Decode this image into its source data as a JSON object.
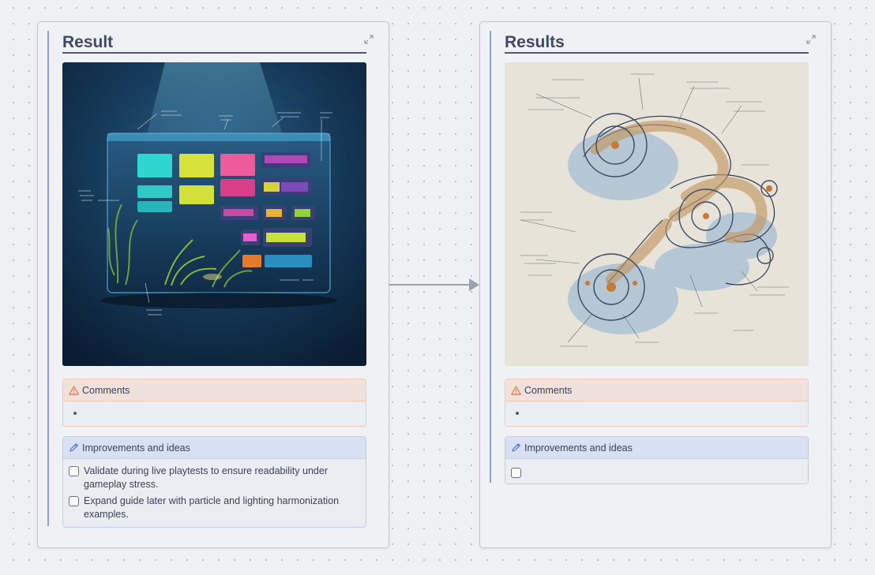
{
  "left_card": {
    "title": "Result",
    "comments": {
      "header": "Comments",
      "items": [
        ""
      ]
    },
    "ideas": {
      "header": "Improvements and ideas",
      "items": [
        "Validate during live playtests to ensure readability under gameplay stress.",
        "Expand guide later with particle and lighting harmonization examples."
      ]
    }
  },
  "right_card": {
    "title": "Results",
    "comments": {
      "header": "Comments",
      "items": [
        ""
      ]
    },
    "ideas": {
      "header": "Improvements and ideas",
      "items": [
        ""
      ]
    }
  },
  "colors": {
    "accent": "#8d9ce8",
    "warning_icon": "#e8743b",
    "pencil_icon": "#4a6cd6",
    "connector": "#9aa0ad"
  },
  "icons": {
    "expand": "expand-icon",
    "warning": "warning-icon",
    "pencil": "pencil-icon"
  }
}
